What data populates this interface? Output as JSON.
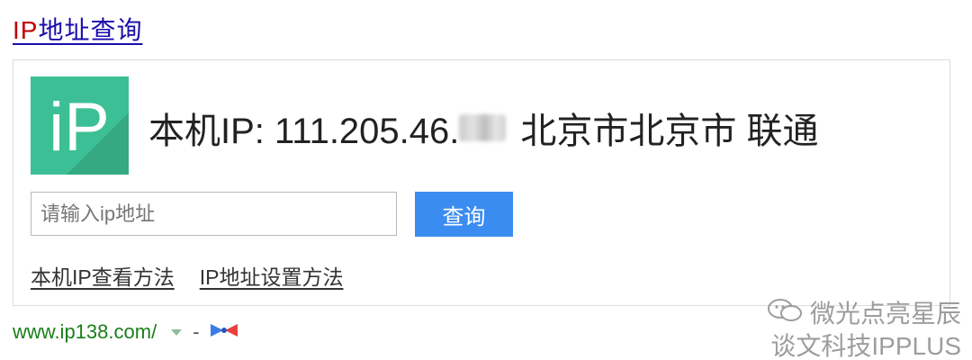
{
  "result": {
    "title_highlight": "IP",
    "title_rest": "地址查询"
  },
  "card": {
    "logo_text": "iP",
    "ip_label": "本机IP: 111.205.46.",
    "location": "北京市北京市 联通",
    "search": {
      "placeholder": "请输入ip地址",
      "button_label": "查询"
    },
    "links": [
      "本机IP查看方法",
      "IP地址设置方法"
    ]
  },
  "source": {
    "url": "www.ip138.com/",
    "dash": "-"
  },
  "watermark": {
    "line1": "微光点亮星辰",
    "line2": "谈文科技IPPLUS"
  },
  "colors": {
    "link_blue": "#1a0dab",
    "highlight_red": "#c00000",
    "logo_green": "#3cbf95",
    "button_blue": "#3b8cf0",
    "url_green": "#1a7f1a"
  }
}
